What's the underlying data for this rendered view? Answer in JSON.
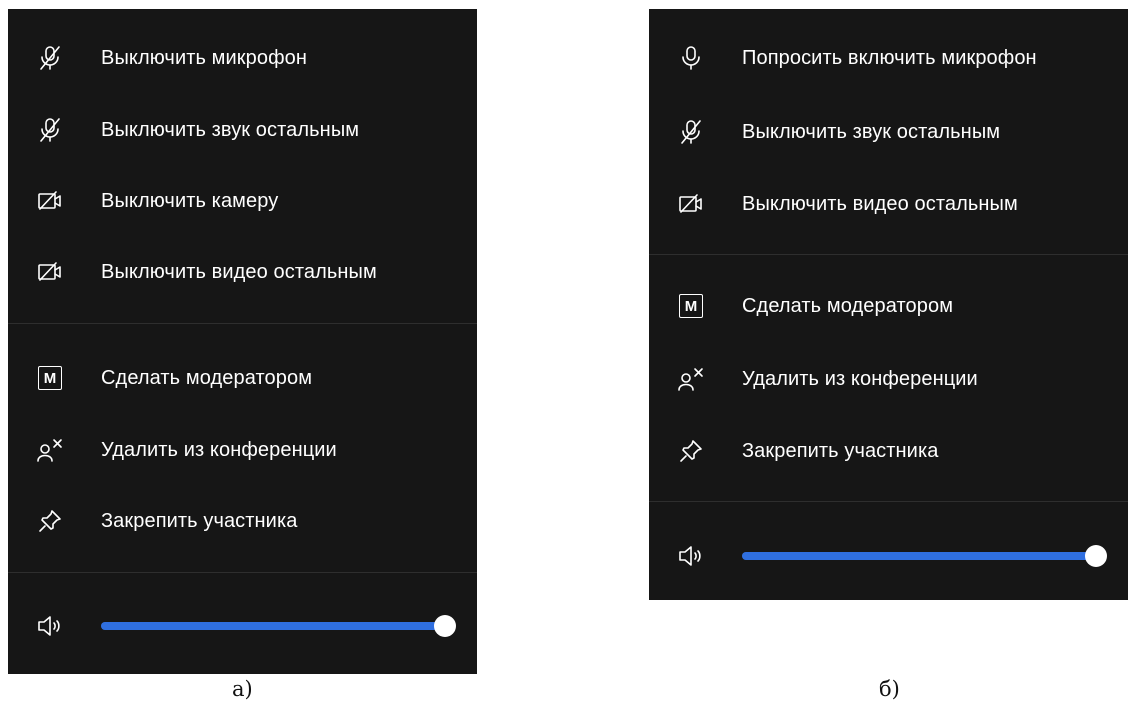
{
  "panel_a": {
    "caption": "а)",
    "items": [
      {
        "label": "Выключить микрофон",
        "icon": "mic-off-icon"
      },
      {
        "label": "Выключить звук остальным",
        "icon": "mic-off-icon"
      },
      {
        "label": "Выключить камеру",
        "icon": "camera-off-icon"
      },
      {
        "label": "Выключить видео остальным",
        "icon": "camera-off-icon"
      },
      {
        "label": "Сделать модератором",
        "icon": "moderator-icon"
      },
      {
        "label": "Удалить из конференции",
        "icon": "remove-user-icon"
      },
      {
        "label": "Закрепить участника",
        "icon": "pin-icon"
      }
    ],
    "volume": {
      "icon": "speaker-icon",
      "level": 1.0
    }
  },
  "panel_b": {
    "caption": "б)",
    "items": [
      {
        "label": "Попросить включить микрофон",
        "icon": "mic-icon"
      },
      {
        "label": "Выключить звук остальным",
        "icon": "mic-off-icon"
      },
      {
        "label": "Выключить видео остальным",
        "icon": "camera-off-icon"
      },
      {
        "label": "Сделать модератором",
        "icon": "moderator-icon"
      },
      {
        "label": "Удалить из конференции",
        "icon": "remove-user-icon"
      },
      {
        "label": "Закрепить участника",
        "icon": "pin-icon"
      }
    ],
    "volume": {
      "icon": "speaker-icon",
      "level": 1.0
    }
  },
  "colors": {
    "panel_background": "#161616",
    "divider": "#2e2e2e",
    "slider_fill": "#2f6fe0",
    "text": "#ffffff"
  },
  "icon_glyphs": {
    "moderator": "M"
  }
}
